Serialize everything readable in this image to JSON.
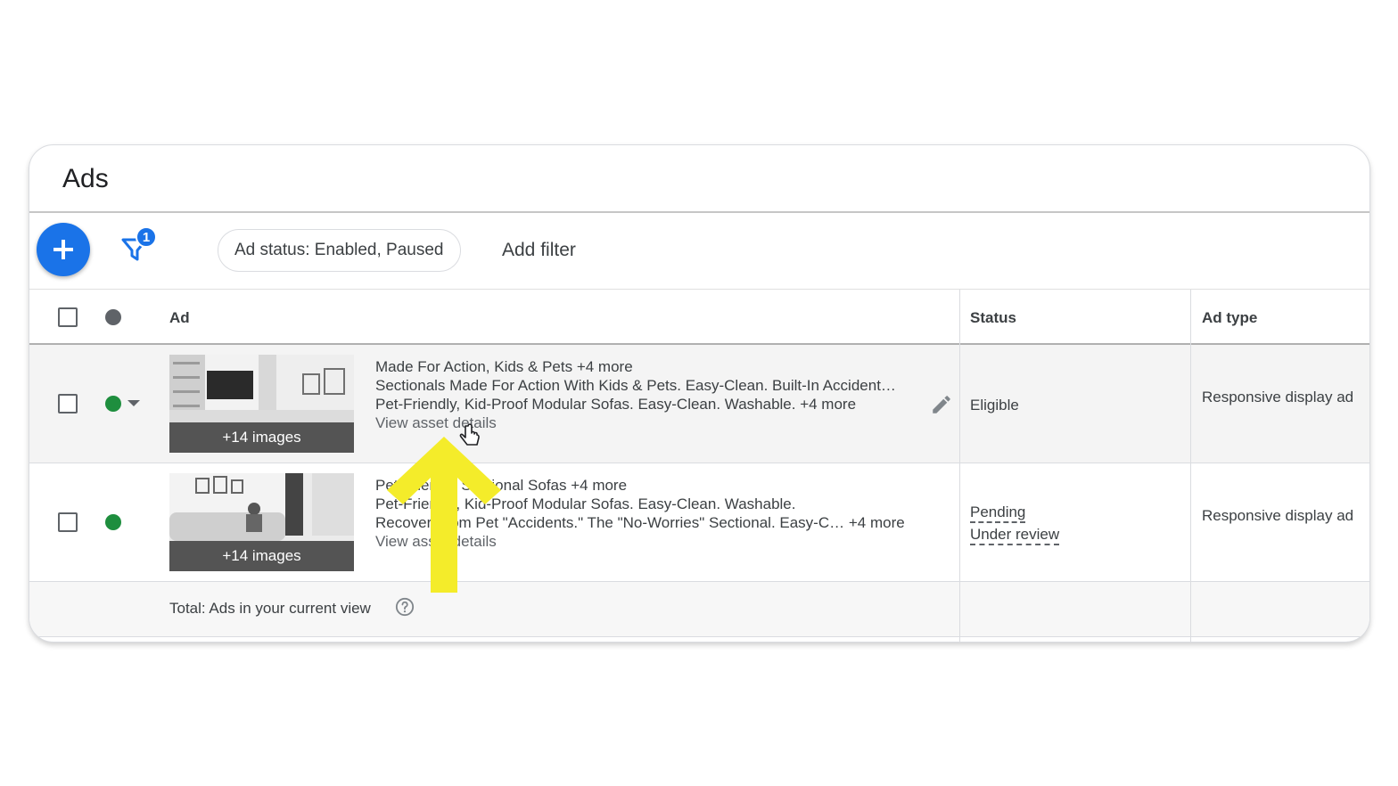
{
  "title": "Ads",
  "toolbar": {
    "filter_count": "1",
    "status_chip": "Ad status: Enabled, Paused",
    "add_filter": "Add filter"
  },
  "columns": {
    "ad": "Ad",
    "status": "Status",
    "ad_type": "Ad type"
  },
  "rows": [
    {
      "images_label": "+14 images",
      "headline": "Made For Action, Kids & Pets +4 more",
      "line2": "Sectionals Made For Action With Kids & Pets. Easy-Clean. Built-In Accident…",
      "line3": "Pet-Friendly, Kid-Proof Modular Sofas. Easy-Clean. Washable. +4 more",
      "link": "View asset details",
      "status": "Eligible",
      "ad_type": "Responsive display ad",
      "status_dot_color": "#1e8e3e"
    },
    {
      "images_label": "+14 images",
      "headline": "Pet-Friendly Sectional Sofas +4 more",
      "line2": "Pet-Friendly, Kid-Proof Modular Sofas. Easy-Clean. Washable.",
      "line3": "Recover From Pet \"Accidents.\" The \"No-Worries\" Sectional. Easy-C… +4 more",
      "link": "View asset details",
      "status_1": "Pending",
      "status_2": "Under review",
      "ad_type": "Responsive display ad",
      "status_dot_color": "#1e8e3e"
    }
  ],
  "total": {
    "label": "Total: Ads in your current view"
  },
  "colors": {
    "accent": "#1a73e8",
    "enabled": "#1e8e3e",
    "header_dot": "#5f6368",
    "arrow": "#f4ec2a"
  }
}
